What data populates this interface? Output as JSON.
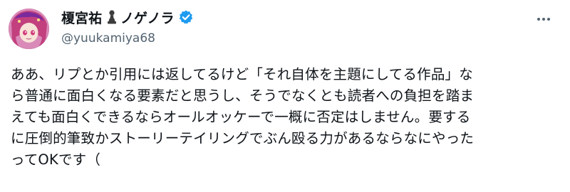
{
  "author": {
    "display_name": "榎宮祐",
    "display_name_suffix": "ノゲノラ",
    "handle": "@yuukamiya68",
    "pawn_icon": "chess-pawn-icon",
    "verified_icon": "verified-badge-icon",
    "verified_color": "#1d9bf0"
  },
  "more_icon": "more-horizontal-icon",
  "tweet": {
    "lines": [
      "ああ、リプとか引用には返してるけど「それ自体を主題にしてる作品」な",
      "ら普通に面白くなる要素だと思うし、そうでなくとも読者への負担を踏ま",
      "えても面白くできるならオールオッケーで一概に否定はしません。要する",
      "に圧倒的筆致かストーリーテイリングでぶん殴る力があるならなにやった",
      "ってOKです（"
    ]
  }
}
